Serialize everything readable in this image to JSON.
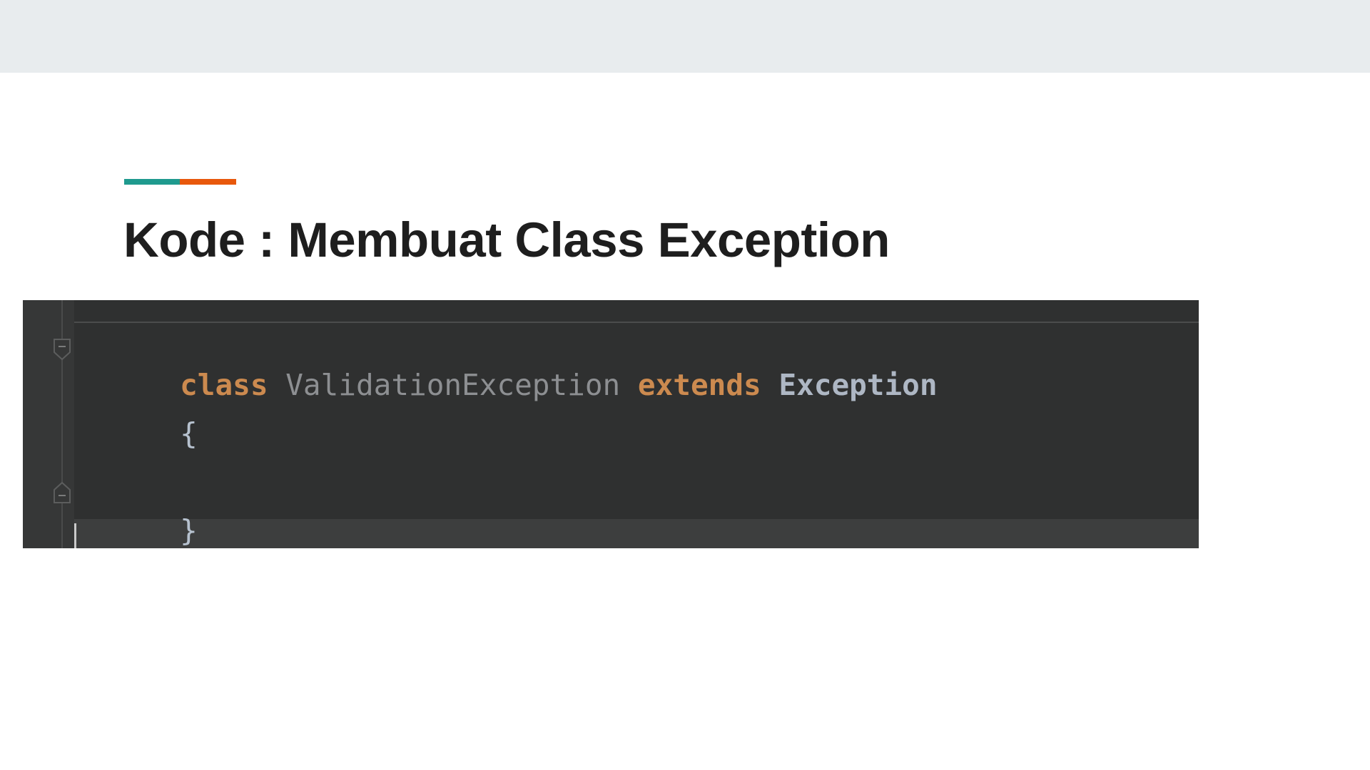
{
  "slide": {
    "title": "Kode : Membuat Class Exception",
    "accent_colors": [
      "#1f9a8e",
      "#e8580c"
    ]
  },
  "editor": {
    "lines": [
      {
        "tokens": [
          {
            "text": "class",
            "kind": "keyword"
          },
          {
            "text": " ",
            "kind": "space"
          },
          {
            "text": "ValidationException",
            "kind": "class-name"
          },
          {
            "text": " ",
            "kind": "space"
          },
          {
            "text": "extends",
            "kind": "keyword"
          },
          {
            "text": " ",
            "kind": "space"
          },
          {
            "text": "Exception",
            "kind": "type"
          }
        ]
      },
      {
        "tokens": [
          {
            "text": "{",
            "kind": "brace"
          }
        ]
      },
      {
        "tokens": []
      },
      {
        "tokens": [
          {
            "text": "}",
            "kind": "brace"
          }
        ]
      }
    ],
    "colors": {
      "background": "#2f3030",
      "keyword": "#cc8a4f",
      "class_name": "#8d8f92",
      "type": "#aeb7c4"
    },
    "gutter_icons": [
      "fold-open-icon",
      "fold-close-icon"
    ]
  }
}
